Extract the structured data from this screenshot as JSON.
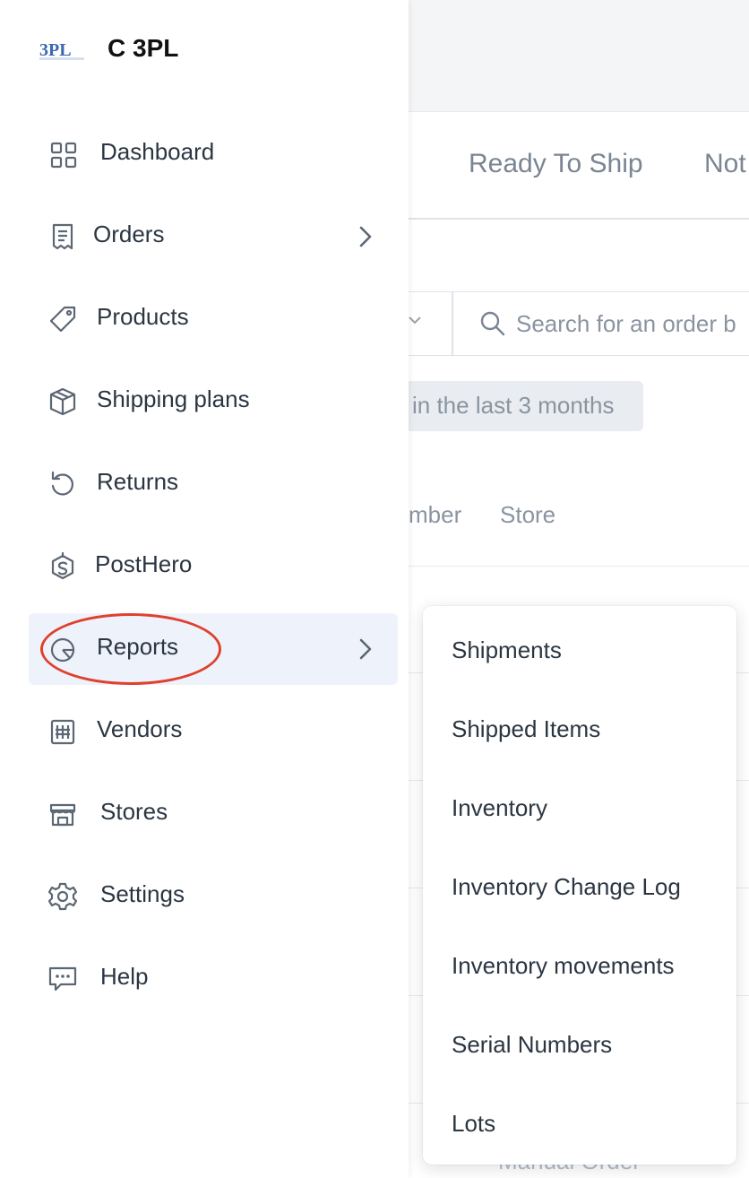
{
  "app": {
    "brand_logo_text": "3PL",
    "brand_name": "C 3PL"
  },
  "sidebar": {
    "items": [
      {
        "label": "Dashboard",
        "icon": "dashboard-icon"
      },
      {
        "label": "Orders",
        "icon": "receipt-icon",
        "has_submenu": true
      },
      {
        "label": "Products",
        "icon": "tag-icon"
      },
      {
        "label": "Shipping plans",
        "icon": "box-icon"
      },
      {
        "label": "Returns",
        "icon": "return-icon"
      },
      {
        "label": "PostHero",
        "icon": "posthero-icon"
      },
      {
        "label": "Reports",
        "icon": "pie-chart-icon",
        "has_submenu": true,
        "active": true,
        "highlighted": true
      },
      {
        "label": "Vendors",
        "icon": "building-icon"
      },
      {
        "label": "Stores",
        "icon": "store-icon"
      },
      {
        "label": "Settings",
        "icon": "gear-icon"
      },
      {
        "label": "Help",
        "icon": "chat-icon"
      }
    ]
  },
  "reports_menu": {
    "items": [
      "Shipments",
      "Shipped Items",
      "Inventory",
      "Inventory Change Log",
      "Inventory movements",
      "Serial Numbers",
      "Lots"
    ]
  },
  "background": {
    "tabs": [
      "Ready To Ship",
      "Not"
    ],
    "search_placeholder": "Search for an order b",
    "date_chip": "in the last 3 months",
    "columns": [
      "mber",
      "Store"
    ],
    "bottom_row_text": "Manual Order"
  },
  "colors": {
    "accent_highlight": "#e0402e",
    "active_bg": "#eef3fb",
    "logo_blue": "#3a68b0"
  }
}
